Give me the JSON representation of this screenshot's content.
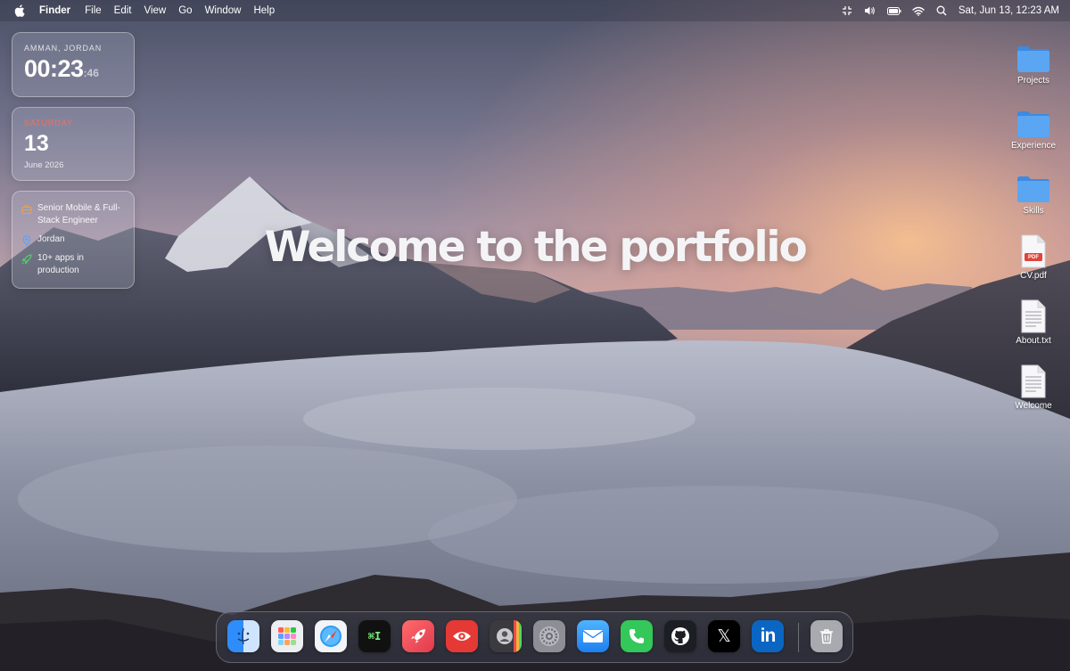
{
  "menubar": {
    "app_name": "Finder",
    "menus": [
      "File",
      "Edit",
      "View",
      "Go",
      "Window",
      "Help"
    ],
    "status_icons": [
      "resize-icon",
      "volume-icon",
      "battery-icon",
      "wifi-icon",
      "search-icon"
    ],
    "clock": "Sat, Jun 13, 12:23 AM"
  },
  "widgets": {
    "clock": {
      "city": "AMMAN, JORDAN",
      "time_hm": "00:23",
      "time_sec": ":46"
    },
    "calendar": {
      "weekday": "SATURDAY",
      "day": "13",
      "month_year": "June 2026"
    },
    "profile": {
      "items": [
        {
          "icon": "briefcase-icon",
          "text": "Senior Mobile & Full-Stack Engineer"
        },
        {
          "icon": "location-pin-icon",
          "text": "Jordan"
        },
        {
          "icon": "rocket-icon",
          "text": "10+ apps in production"
        }
      ]
    }
  },
  "headline": "Welcome to the portfolio",
  "desktop_icons": [
    {
      "label": "Projects",
      "icon": "folder-icon"
    },
    {
      "label": "Experience",
      "icon": "folder-icon"
    },
    {
      "label": "Skills",
      "icon": "folder-icon"
    },
    {
      "label": "CV.pdf",
      "icon": "pdf-file-icon",
      "badge": "PDF"
    },
    {
      "label": "About.txt",
      "icon": "text-file-icon"
    },
    {
      "label": "Welcome",
      "icon": "text-file-icon"
    }
  ],
  "dock": {
    "apps": [
      "finder-icon",
      "launchpad-icon",
      "safari-icon",
      "terminal-icon",
      "rocket-app-icon",
      "eye-app-icon",
      "contacts-icon",
      "system-settings-icon",
      "mail-icon",
      "phone-icon",
      "github-icon",
      "x-icon",
      "linkedin-icon"
    ],
    "trash": "trash-icon",
    "terminal_glyph": "⌘I",
    "linkedin_text": "in",
    "x_text": "𝕏"
  },
  "colors": {
    "accent_red": "#ff6b5a",
    "headline": "#f4f4f6"
  }
}
